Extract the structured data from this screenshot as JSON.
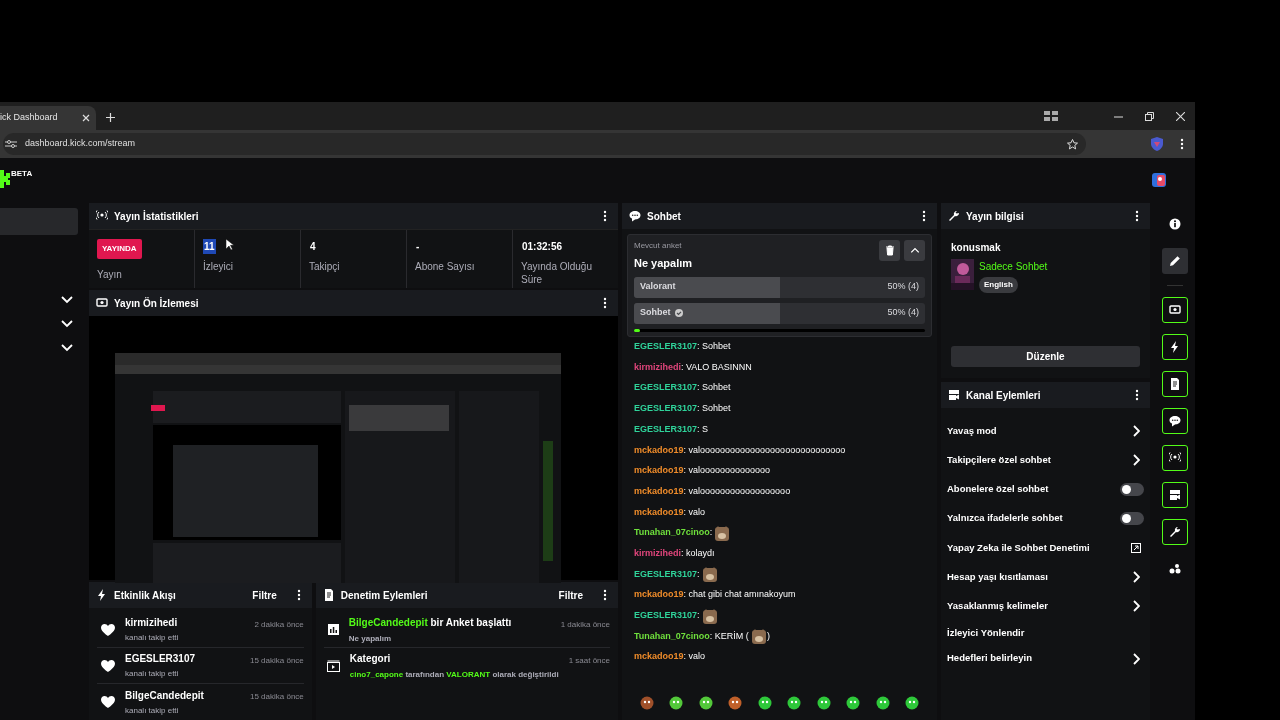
{
  "browser": {
    "tab_title": "ick Dashboard",
    "url": "dashboard.kick.com/stream"
  },
  "logo": {
    "badge": "BETA"
  },
  "sidebar": {
    "items": [
      {
        "selected": true
      }
    ],
    "sections": [
      {
        "expanded": false
      },
      {
        "expanded": false
      },
      {
        "expanded": false
      }
    ]
  },
  "stats": {
    "title": "Yayın İstatistikleri",
    "items": [
      {
        "kind": "badge",
        "value": "YAYINDA",
        "label": "Yayın"
      },
      {
        "kind": "number",
        "value": "11",
        "label": "İzleyici",
        "highlighted": true
      },
      {
        "kind": "number",
        "value": "4",
        "label": "Takipçi",
        "highlighted": false
      },
      {
        "kind": "number",
        "value": "-",
        "label": "Abone Sayısı",
        "highlighted": false
      },
      {
        "kind": "number",
        "value": "01:32:56",
        "label": "Yayında Olduğu Süre",
        "highlighted": false
      }
    ]
  },
  "preview": {
    "title": "Yayın Ön İzlemesi"
  },
  "activity": {
    "title": "Etkinlik Akışı",
    "filter": "Filtre",
    "events": [
      {
        "name": "kirmizihedi",
        "action": "kanalı takip etti",
        "time": "2 dakika önce"
      },
      {
        "name": "EGESLER3107",
        "action": "kanalı takip etti",
        "time": "15 dakika önce"
      },
      {
        "name": "BilgeCandedepit",
        "action": "kanalı takip etti",
        "time": "15 dakika önce"
      }
    ]
  },
  "moderation": {
    "title": "Denetim Eylemleri",
    "filter": "Filtre",
    "actions": [
      {
        "kind": "poll",
        "title": [
          {
            "text": "BilgeCandedepit",
            "highlight": true
          },
          {
            "text": " bir Anket başlattı",
            "highlight": false
          }
        ],
        "detail": [
          {
            "text": "Ne yapalım",
            "highlight": false
          }
        ],
        "time": "1 dakika önce"
      },
      {
        "kind": "category",
        "title": [
          {
            "text": "Kategori",
            "highlight": false
          }
        ],
        "detail": [
          {
            "text": "cino7_capone",
            "highlight": true
          },
          {
            "text": " tarafından ",
            "highlight": false
          },
          {
            "text": "VALORANT",
            "highlight": true
          },
          {
            "text": " olarak değiştirildi",
            "highlight": false
          }
        ],
        "time": "1 saat önce"
      }
    ]
  },
  "chat": {
    "title": "Sohbet",
    "poll": {
      "label": "Mevcut anket",
      "question": "Ne yapalım",
      "timer": {
        "level": 0.02
      },
      "options": [
        {
          "label": "Valorant",
          "result": "50% (4)",
          "level": 0.5,
          "voted": false
        },
        {
          "label": "Sohbet",
          "result": "50% (4)",
          "level": 0.5,
          "voted": true
        }
      ]
    },
    "messages": [
      {
        "user": "EGESLER3107",
        "color": "#2fd39a",
        "parts": [
          {
            "kind": "text",
            "text": ": Sohbet"
          }
        ]
      },
      {
        "user": "kirmizihedi",
        "color": "#e0457b",
        "parts": [
          {
            "kind": "text",
            "text": ": VALO BASINNN"
          }
        ]
      },
      {
        "user": "EGESLER3107",
        "color": "#2fd39a",
        "parts": [
          {
            "kind": "text",
            "text": ": Sohbet"
          }
        ]
      },
      {
        "user": "EGESLER3107",
        "color": "#2fd39a",
        "parts": [
          {
            "kind": "text",
            "text": ": Sohbet"
          }
        ]
      },
      {
        "user": "EGESLER3107",
        "color": "#2fd39a",
        "parts": [
          {
            "kind": "text",
            "text": ": S"
          }
        ]
      },
      {
        "user": "mckadoo19",
        "color": "#f08c2a",
        "parts": [
          {
            "kind": "text",
            "text": ": valooooooooooooooooooooooooooooo"
          }
        ]
      },
      {
        "user": "mckadoo19",
        "color": "#f08c2a",
        "parts": [
          {
            "kind": "text",
            "text": ": valoooooooooooooo"
          }
        ]
      },
      {
        "user": "mckadoo19",
        "color": "#f08c2a",
        "parts": [
          {
            "kind": "text",
            "text": ": valoooooooooooooooooo"
          }
        ]
      },
      {
        "user": "mckadoo19",
        "color": "#f08c2a",
        "parts": [
          {
            "kind": "text",
            "text": ": valo"
          }
        ]
      },
      {
        "user": "Tunahan_07cinoo",
        "color": "#6fe03c",
        "parts": [
          {
            "kind": "text",
            "text": ":"
          },
          {
            "kind": "emote"
          }
        ]
      },
      {
        "user": "kirmizihedi",
        "color": "#e0457b",
        "parts": [
          {
            "kind": "text",
            "text": ": kolaydı"
          }
        ]
      },
      {
        "user": "EGESLER3107",
        "color": "#2fd39a",
        "parts": [
          {
            "kind": "text",
            "text": ":"
          },
          {
            "kind": "emote"
          }
        ]
      },
      {
        "user": "mckadoo19",
        "color": "#f08c2a",
        "parts": [
          {
            "kind": "text",
            "text": ": chat gibi chat amınakoyum"
          }
        ]
      },
      {
        "user": "EGESLER3107",
        "color": "#2fd39a",
        "parts": [
          {
            "kind": "text",
            "text": ":"
          },
          {
            "kind": "emote"
          }
        ]
      },
      {
        "user": "Tunahan_07cinoo",
        "color": "#6fe03c",
        "parts": [
          {
            "kind": "text",
            "text": ": KERİM ("
          },
          {
            "kind": "emote"
          },
          {
            "kind": "text",
            "text": ")"
          }
        ]
      },
      {
        "user": "mckadoo19",
        "color": "#f08c2a",
        "parts": [
          {
            "kind": "text",
            "text": ": valo"
          }
        ]
      }
    ]
  },
  "stream_info": {
    "title": "Yayın bilgisi",
    "stream_title": "konusmak",
    "category": "Sadece Sohbet",
    "tag": "English",
    "edit_button": "Düzenle"
  },
  "channel_actions": {
    "title": "Kanal Eylemleri",
    "items": [
      {
        "kind": "chevron",
        "label": "Yavaş mod"
      },
      {
        "kind": "chevron",
        "label": "Takipçilere özel sohbet"
      },
      {
        "kind": "toggle",
        "label": "Abonelere özel sohbet",
        "on": false
      },
      {
        "kind": "toggle",
        "label": "Yalnızca ifadelerle sohbet",
        "on": false
      },
      {
        "kind": "external",
        "label": "Yapay Zeka ile Sohbet Denetimi"
      },
      {
        "kind": "chevron",
        "label": "Hesap yaşı kısıtlaması"
      },
      {
        "kind": "chevron",
        "label": "Yasaklanmış kelimeler"
      },
      {
        "kind": "plain",
        "label": "İzleyici Yönlendir"
      },
      {
        "kind": "chevron",
        "label": "Hedefleri belirleyin"
      }
    ]
  },
  "rail": [
    {
      "selected": false,
      "pinned": false
    },
    {
      "selected": true,
      "pinned": false
    },
    {
      "selected": false,
      "pinned": true
    },
    {
      "selected": false,
      "pinned": true
    },
    {
      "selected": false,
      "pinned": true
    },
    {
      "selected": false,
      "pinned": true
    },
    {
      "selected": false,
      "pinned": true
    },
    {
      "selected": false,
      "pinned": true
    },
    {
      "selected": false,
      "pinned": true
    },
    {
      "selected": false,
      "pinned": false
    }
  ]
}
